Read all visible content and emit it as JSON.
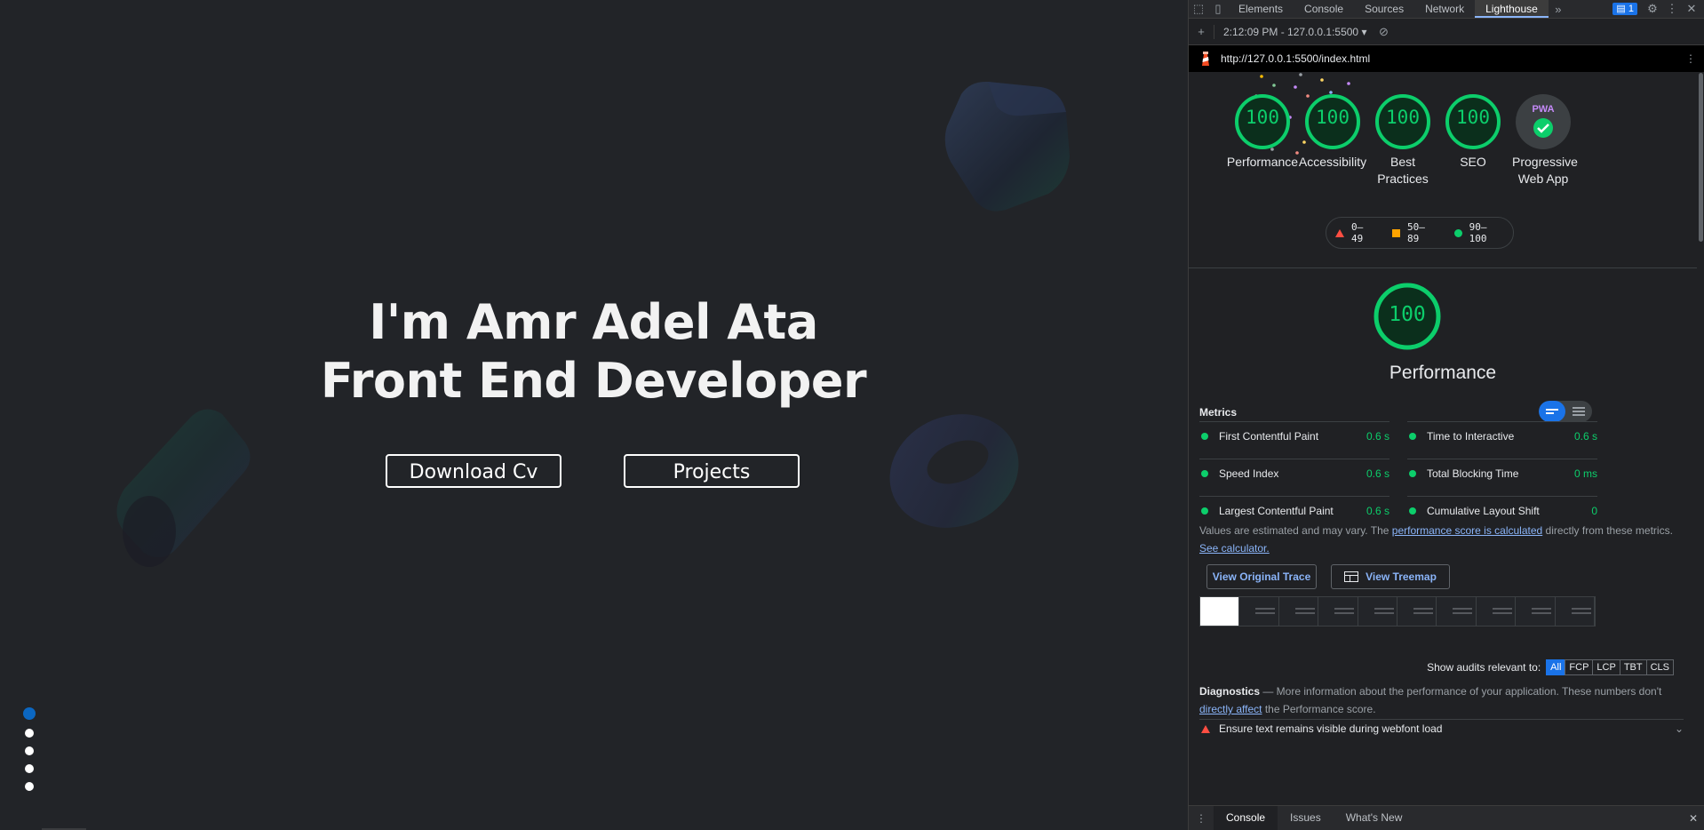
{
  "hero": {
    "line1": "I'm Amr Adel Ata",
    "line2": "Front End Developer",
    "download_label": "Download Cv",
    "projects_label": "Projects"
  },
  "devtools": {
    "tabs": [
      "Elements",
      "Console",
      "Sources",
      "Network",
      "Lighthouse"
    ],
    "active_tab": "Lighthouse",
    "issues_count": "1",
    "report_selector": "2:12:09 PM - 127.0.0.1:5500",
    "url": "http://127.0.0.1:5500/index.html",
    "categories": [
      {
        "label": "Performance",
        "score": "100"
      },
      {
        "label": "Accessibility",
        "score": "100"
      },
      {
        "label": "Best Practices",
        "score": "100"
      },
      {
        "label": "SEO",
        "score": "100"
      },
      {
        "label": "Progressive Web App",
        "badge": "PWA"
      }
    ],
    "legend": {
      "low": "0–49",
      "mid": "50–89",
      "high": "90–100"
    },
    "performance": {
      "score": "100",
      "title": "Performance"
    },
    "metrics_heading": "Metrics",
    "metrics": [
      {
        "name": "First Contentful Paint",
        "value": "0.6 s"
      },
      {
        "name": "Time to Interactive",
        "value": "0.6 s"
      },
      {
        "name": "Speed Index",
        "value": "0.6 s"
      },
      {
        "name": "Total Blocking Time",
        "value": "0 ms"
      },
      {
        "name": "Largest Contentful Paint",
        "value": "0.6 s"
      },
      {
        "name": "Cumulative Layout Shift",
        "value": "0"
      }
    ],
    "note": {
      "prefix": "Values are estimated and may vary. The ",
      "link1": "performance score is calculated",
      "middle": " directly from these metrics. ",
      "link2": "See calculator."
    },
    "view_trace": "View Original Trace",
    "view_treemap": "View Treemap",
    "show_audits_label": "Show audits relevant to:",
    "audit_filters": [
      "All",
      "FCP",
      "LCP",
      "TBT",
      "CLS"
    ],
    "diagnostics": {
      "title": "Diagnostics",
      "text": " — More information about the performance of your application. These numbers don't ",
      "link": "directly affect",
      "suffix": " the Performance score."
    },
    "first_audit": "Ensure text remains visible during webfont load",
    "drawer_tabs": [
      "Console",
      "Issues",
      "What's New"
    ],
    "colors": {
      "pass": "#0cce6b",
      "average": "#ffa400",
      "fail": "#ff4e42",
      "accent": "#1a73e8"
    }
  }
}
